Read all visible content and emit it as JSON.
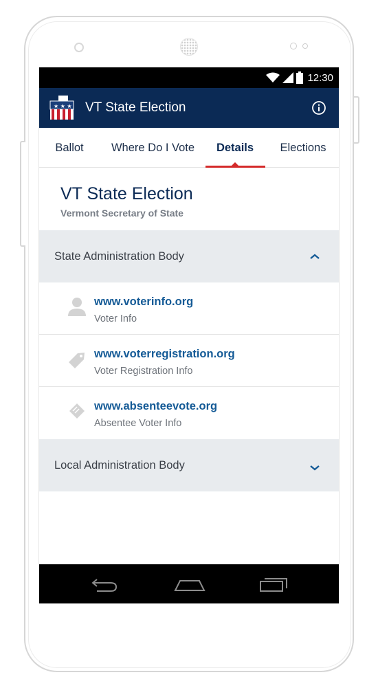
{
  "status_bar": {
    "time": "12:30"
  },
  "app_bar": {
    "title": "VT State Election",
    "logo_icon": "ballot-box-icon",
    "info_icon": "info-icon"
  },
  "tabs": [
    {
      "label": "Ballot",
      "active": false
    },
    {
      "label": "Where Do I Vote",
      "active": false
    },
    {
      "label": "Details",
      "active": true
    },
    {
      "label": "Elections",
      "active": false
    }
  ],
  "election": {
    "title": "VT State Election",
    "subtitle": "Vermont Secretary of State"
  },
  "sections": [
    {
      "title": "State Administration Body",
      "expanded": true,
      "items": [
        {
          "icon": "person-icon",
          "url": "www.voterinfo.org",
          "description": "Voter Info"
        },
        {
          "icon": "tag-icon",
          "url": "www.voterregistration.org",
          "description": "Voter Registration Info"
        },
        {
          "icon": "ticket-icon",
          "url": "www.absenteevote.org",
          "description": "Absentee Voter Info"
        }
      ]
    },
    {
      "title": "Local Administration Body",
      "expanded": false,
      "items": []
    }
  ],
  "colors": {
    "app_bar": "#0b2a55",
    "accent": "#d42a2a",
    "link": "#145a96",
    "section_bg": "#e8ebee"
  }
}
